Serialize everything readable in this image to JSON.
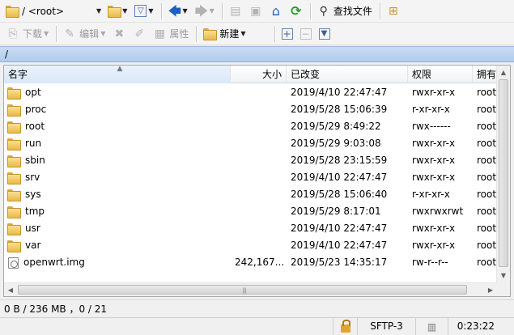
{
  "toolbar1": {
    "path_combo": "/ <root>",
    "find_files": "查找文件"
  },
  "toolbar2": {
    "download": "下载",
    "edit": "编辑",
    "properties": "属性",
    "new": "新建"
  },
  "path": "/",
  "columns": {
    "name": "名字",
    "size": "大小",
    "modified": "已改变",
    "permissions": "权限",
    "owner": "拥有"
  },
  "files": [
    {
      "type": "folder",
      "name": "opt",
      "size": "",
      "modified": "2019/4/10 22:47:47",
      "permissions": "rwxr-xr-x",
      "owner": "root"
    },
    {
      "type": "folder",
      "name": "proc",
      "size": "",
      "modified": "2019/5/28 15:06:39",
      "permissions": "r-xr-xr-x",
      "owner": "root"
    },
    {
      "type": "folder",
      "name": "root",
      "size": "",
      "modified": "2019/5/29 8:49:22",
      "permissions": "rwx------",
      "owner": "root"
    },
    {
      "type": "folder",
      "name": "run",
      "size": "",
      "modified": "2019/5/29 9:03:08",
      "permissions": "rwxr-xr-x",
      "owner": "root"
    },
    {
      "type": "folder",
      "name": "sbin",
      "size": "",
      "modified": "2019/5/28 23:15:59",
      "permissions": "rwxr-xr-x",
      "owner": "root"
    },
    {
      "type": "folder",
      "name": "srv",
      "size": "",
      "modified": "2019/4/10 22:47:47",
      "permissions": "rwxr-xr-x",
      "owner": "root"
    },
    {
      "type": "folder",
      "name": "sys",
      "size": "",
      "modified": "2019/5/28 15:06:40",
      "permissions": "r-xr-xr-x",
      "owner": "root"
    },
    {
      "type": "folder",
      "name": "tmp",
      "size": "",
      "modified": "2019/5/29 8:17:01",
      "permissions": "rwxrwxrwt",
      "owner": "root"
    },
    {
      "type": "folder",
      "name": "usr",
      "size": "",
      "modified": "2019/4/10 22:47:47",
      "permissions": "rwxr-xr-x",
      "owner": "root"
    },
    {
      "type": "folder",
      "name": "var",
      "size": "",
      "modified": "2019/4/10 22:47:47",
      "permissions": "rwxr-xr-x",
      "owner": "root"
    },
    {
      "type": "file",
      "name": "openwrt.img",
      "size": "242,167...",
      "modified": "2019/5/23 14:35:17",
      "permissions": "rw-r--r--",
      "owner": "root"
    }
  ],
  "status": "0 B / 236 MB ，0 / 21",
  "bottom": {
    "protocol": "SFTP-3",
    "time": "0:23:22"
  },
  "colors": {
    "path_bar": "#b9d1ee",
    "folder": "#f2c75c",
    "accent_blue": "#1e5fbf"
  }
}
